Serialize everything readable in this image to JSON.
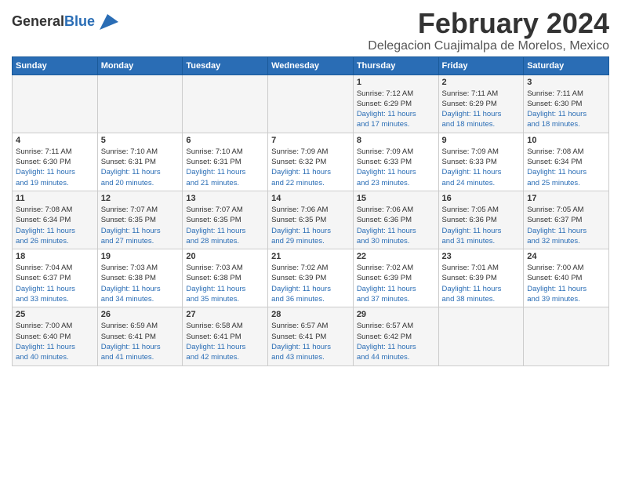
{
  "header": {
    "logo_general": "General",
    "logo_blue": "Blue",
    "main_title": "February 2024",
    "subtitle": "Delegacion Cuajimalpa de Morelos, Mexico"
  },
  "days_of_week": [
    "Sunday",
    "Monday",
    "Tuesday",
    "Wednesday",
    "Thursday",
    "Friday",
    "Saturday"
  ],
  "weeks": [
    [
      {
        "day": "",
        "sunrise": "",
        "sunset": "",
        "daylight": ""
      },
      {
        "day": "",
        "sunrise": "",
        "sunset": "",
        "daylight": ""
      },
      {
        "day": "",
        "sunrise": "",
        "sunset": "",
        "daylight": ""
      },
      {
        "day": "",
        "sunrise": "",
        "sunset": "",
        "daylight": ""
      },
      {
        "day": "1",
        "sunrise": "7:12 AM",
        "sunset": "6:29 PM",
        "daylight": "11 hours and 17 minutes."
      },
      {
        "day": "2",
        "sunrise": "7:11 AM",
        "sunset": "6:29 PM",
        "daylight": "11 hours and 18 minutes."
      },
      {
        "day": "3",
        "sunrise": "7:11 AM",
        "sunset": "6:30 PM",
        "daylight": "11 hours and 18 minutes."
      }
    ],
    [
      {
        "day": "4",
        "sunrise": "7:11 AM",
        "sunset": "6:30 PM",
        "daylight": "11 hours and 19 minutes."
      },
      {
        "day": "5",
        "sunrise": "7:10 AM",
        "sunset": "6:31 PM",
        "daylight": "11 hours and 20 minutes."
      },
      {
        "day": "6",
        "sunrise": "7:10 AM",
        "sunset": "6:31 PM",
        "daylight": "11 hours and 21 minutes."
      },
      {
        "day": "7",
        "sunrise": "7:09 AM",
        "sunset": "6:32 PM",
        "daylight": "11 hours and 22 minutes."
      },
      {
        "day": "8",
        "sunrise": "7:09 AM",
        "sunset": "6:33 PM",
        "daylight": "11 hours and 23 minutes."
      },
      {
        "day": "9",
        "sunrise": "7:09 AM",
        "sunset": "6:33 PM",
        "daylight": "11 hours and 24 minutes."
      },
      {
        "day": "10",
        "sunrise": "7:08 AM",
        "sunset": "6:34 PM",
        "daylight": "11 hours and 25 minutes."
      }
    ],
    [
      {
        "day": "11",
        "sunrise": "7:08 AM",
        "sunset": "6:34 PM",
        "daylight": "11 hours and 26 minutes."
      },
      {
        "day": "12",
        "sunrise": "7:07 AM",
        "sunset": "6:35 PM",
        "daylight": "11 hours and 27 minutes."
      },
      {
        "day": "13",
        "sunrise": "7:07 AM",
        "sunset": "6:35 PM",
        "daylight": "11 hours and 28 minutes."
      },
      {
        "day": "14",
        "sunrise": "7:06 AM",
        "sunset": "6:35 PM",
        "daylight": "11 hours and 29 minutes."
      },
      {
        "day": "15",
        "sunrise": "7:06 AM",
        "sunset": "6:36 PM",
        "daylight": "11 hours and 30 minutes."
      },
      {
        "day": "16",
        "sunrise": "7:05 AM",
        "sunset": "6:36 PM",
        "daylight": "11 hours and 31 minutes."
      },
      {
        "day": "17",
        "sunrise": "7:05 AM",
        "sunset": "6:37 PM",
        "daylight": "11 hours and 32 minutes."
      }
    ],
    [
      {
        "day": "18",
        "sunrise": "7:04 AM",
        "sunset": "6:37 PM",
        "daylight": "11 hours and 33 minutes."
      },
      {
        "day": "19",
        "sunrise": "7:03 AM",
        "sunset": "6:38 PM",
        "daylight": "11 hours and 34 minutes."
      },
      {
        "day": "20",
        "sunrise": "7:03 AM",
        "sunset": "6:38 PM",
        "daylight": "11 hours and 35 minutes."
      },
      {
        "day": "21",
        "sunrise": "7:02 AM",
        "sunset": "6:39 PM",
        "daylight": "11 hours and 36 minutes."
      },
      {
        "day": "22",
        "sunrise": "7:02 AM",
        "sunset": "6:39 PM",
        "daylight": "11 hours and 37 minutes."
      },
      {
        "day": "23",
        "sunrise": "7:01 AM",
        "sunset": "6:39 PM",
        "daylight": "11 hours and 38 minutes."
      },
      {
        "day": "24",
        "sunrise": "7:00 AM",
        "sunset": "6:40 PM",
        "daylight": "11 hours and 39 minutes."
      }
    ],
    [
      {
        "day": "25",
        "sunrise": "7:00 AM",
        "sunset": "6:40 PM",
        "daylight": "11 hours and 40 minutes."
      },
      {
        "day": "26",
        "sunrise": "6:59 AM",
        "sunset": "6:41 PM",
        "daylight": "11 hours and 41 minutes."
      },
      {
        "day": "27",
        "sunrise": "6:58 AM",
        "sunset": "6:41 PM",
        "daylight": "11 hours and 42 minutes."
      },
      {
        "day": "28",
        "sunrise": "6:57 AM",
        "sunset": "6:41 PM",
        "daylight": "11 hours and 43 minutes."
      },
      {
        "day": "29",
        "sunrise": "6:57 AM",
        "sunset": "6:42 PM",
        "daylight": "11 hours and 44 minutes."
      },
      {
        "day": "",
        "sunrise": "",
        "sunset": "",
        "daylight": ""
      },
      {
        "day": "",
        "sunrise": "",
        "sunset": "",
        "daylight": ""
      }
    ]
  ],
  "labels": {
    "sunrise": "Sunrise:",
    "sunset": "Sunset:",
    "daylight": "Daylight:"
  }
}
